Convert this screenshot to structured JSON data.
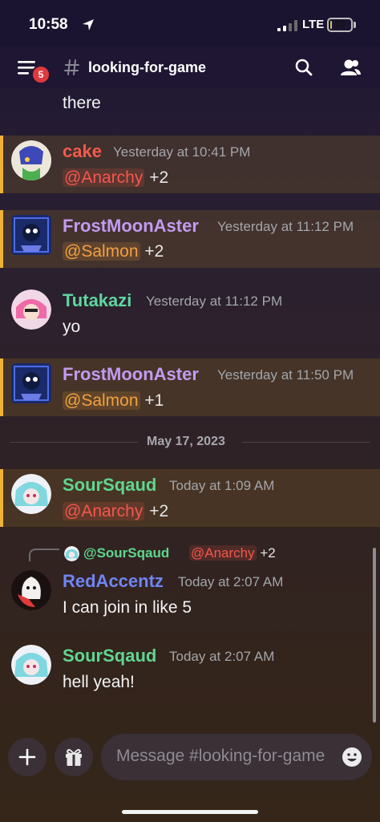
{
  "status_bar": {
    "time": "10:58",
    "network": "LTE",
    "battery": "10",
    "battery_level": 0.1
  },
  "header": {
    "channel": "looking-for-game",
    "unread_badge": "5",
    "icons": [
      "menu-icon",
      "hash-icon",
      "search-icon",
      "members-icon"
    ]
  },
  "messages": [
    {
      "text": "there"
    },
    {
      "author": "cake",
      "author_color": "#f15a4a",
      "time": "Yesterday at 10:41 PM",
      "mention": "@Anarchy",
      "suffix": "+2",
      "highlighted": true
    },
    {
      "author": "FrostMoonAster",
      "author_color": "#c39bf0",
      "time": "Yesterday at 11:12 PM",
      "mention": "@Salmon",
      "suffix": "+2",
      "highlighted": true
    },
    {
      "author": "Tutakazi",
      "author_color": "#5fd6a0",
      "time": "Yesterday at 11:12 PM",
      "text": "yo"
    },
    {
      "author": "FrostMoonAster",
      "author_color": "#c39bf0",
      "time": "Yesterday at 11:50 PM",
      "mention": "@Salmon",
      "suffix": "+1",
      "highlighted": true
    },
    {
      "author": "SourSqaud",
      "author_color": "#5fd68f",
      "time": "Today at 1:09 AM",
      "mention": "@Anarchy",
      "suffix": "+2",
      "highlighted": true
    },
    {
      "reply_to": {
        "author": "@SourSqaud",
        "mention": "@Anarchy",
        "suffix": "+2"
      },
      "author": "RedAccentz",
      "author_color": "#6f85f2",
      "time": "Today at 2:07 AM",
      "text": "I can join in like 5"
    },
    {
      "author": "SourSqaud",
      "author_color": "#5fd68f",
      "time": "Today at 2:07 AM",
      "text": "hell yeah!"
    }
  ],
  "date_divider": "May 17, 2023",
  "composer": {
    "placeholder": "Message #looking-for-game",
    "icons": [
      "plus-icon",
      "gift-icon",
      "emoji-icon"
    ]
  }
}
